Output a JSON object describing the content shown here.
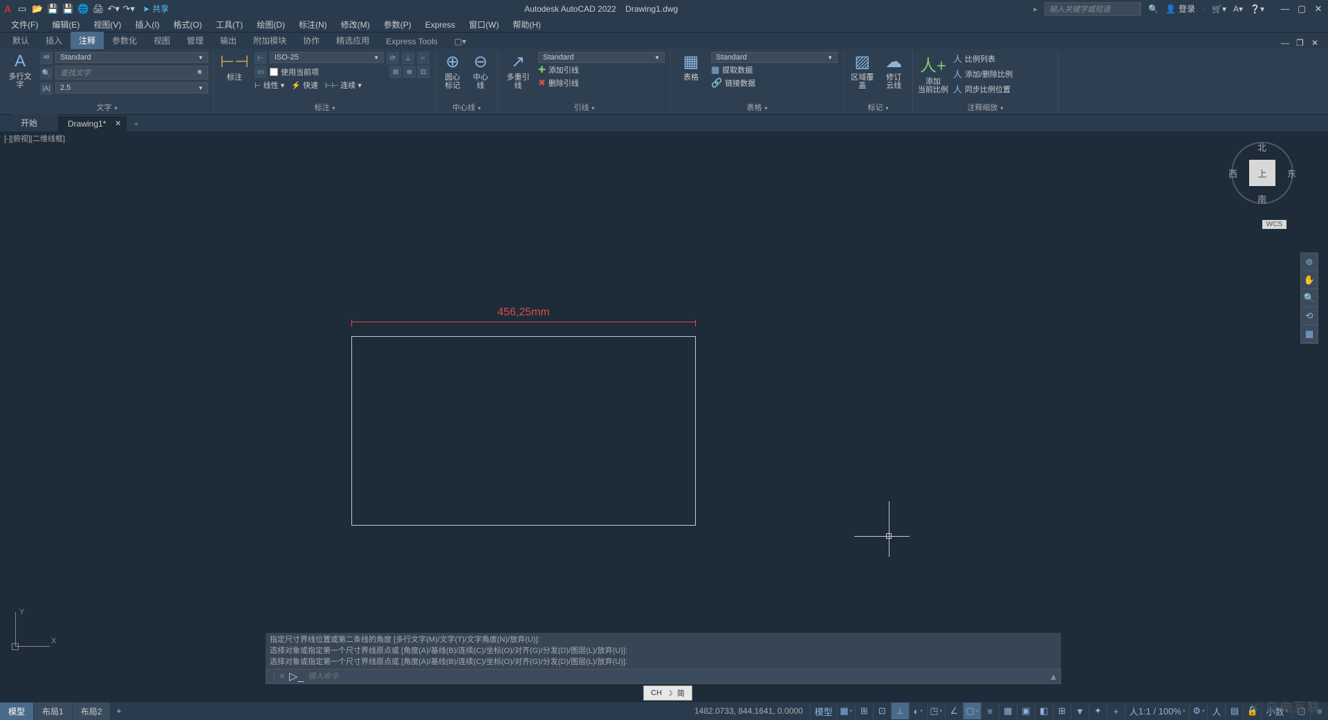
{
  "title": {
    "app": "Autodesk AutoCAD 2022",
    "doc": "Drawing1.dwg",
    "share": "共享",
    "search_placeholder": "输入关键字或短语",
    "login": "登录"
  },
  "menu": [
    "文件(F)",
    "编辑(E)",
    "视图(V)",
    "插入(I)",
    "格式(O)",
    "工具(T)",
    "绘图(D)",
    "标注(N)",
    "修改(M)",
    "参数(P)",
    "Express",
    "窗口(W)",
    "帮助(H)"
  ],
  "ribbon_tabs": [
    "默认",
    "插入",
    "注释",
    "参数化",
    "视图",
    "管理",
    "输出",
    "附加模块",
    "协作",
    "精选应用",
    "Express Tools"
  ],
  "active_ribbon_tab": 2,
  "panels": {
    "text": {
      "label": "文字",
      "big": "多行文字",
      "style": "Standard",
      "find_ph": "查找文字",
      "height": "2.5"
    },
    "dim": {
      "label": "标注",
      "big": "标注",
      "style": "ISO-25",
      "use_current": "使用当前项",
      "linear": "线性",
      "quick": "快速",
      "continue": "连续"
    },
    "center": {
      "label": "中心线",
      "b1": "圆心\n标记",
      "b2": "中心线"
    },
    "leader": {
      "label": "引线",
      "big": "多重引线",
      "style": "Standard",
      "add": "添加引线",
      "remove": "删除引线"
    },
    "table": {
      "label": "表格",
      "big": "表格",
      "style": "Standard",
      "extract": "提取数据",
      "link": "链接数据"
    },
    "markup": {
      "label": "标记",
      "b1": "区域覆盖",
      "b2": "修订\n云线"
    },
    "anno": {
      "label": "注释缩放",
      "big": "添加\n当前比例",
      "list": "比例列表",
      "adddel": "添加/删除比例",
      "sync": "同步比例位置"
    }
  },
  "file_tabs": {
    "start": "开始",
    "doc": "Drawing1*"
  },
  "viewport_label": "[-][俯视][二维线框]",
  "viewcube": {
    "face": "上",
    "n": "北",
    "s": "南",
    "e": "东",
    "w": "西",
    "wcs": "WCS"
  },
  "dimension_text": "456,25mm",
  "ucs": {
    "x": "X",
    "y": "Y"
  },
  "cmd": {
    "h1": "指定尺寸界线位置或第二条线的角度 [多行文字(M)/文字(T)/文字角度(N)/放弃(U)]:",
    "h2": "选择对象或指定第一个尺寸界线原点或 [角度(A)/基线(B)/连续(C)/坐标(O)/对齐(G)/分发(D)/图层(L)/放弃(U)]:",
    "h3": "选择对象或指定第一个尺寸界线原点或 [角度(A)/基线(B)/连续(C)/坐标(O)/对齐(G)/分发(D)/图层(L)/放弃(U)]:",
    "ph": "键入命令"
  },
  "ime": {
    "lang": "CH",
    "mode": "简"
  },
  "status": {
    "layouts": [
      "模型",
      "布局1",
      "布局2"
    ],
    "coords": "1482.0733, 844.1641, 0.0000",
    "model": "模型",
    "scale": "1:1 / 100%",
    "decimal": "小数"
  }
}
